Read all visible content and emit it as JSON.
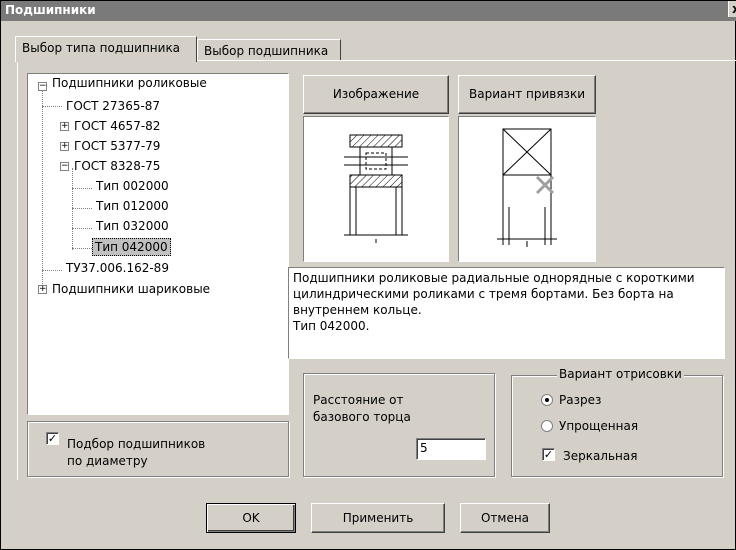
{
  "window": {
    "title": "Подшипники",
    "close_label": "x"
  },
  "tabs": [
    {
      "label": "Выбор типа подшипника",
      "active": true
    },
    {
      "label": "Выбор подшипника",
      "active": false
    }
  ],
  "tree": {
    "items": [
      {
        "label": "Подшипники роликовые",
        "expander": "−"
      },
      {
        "label": "ГОСТ 27365-87"
      },
      {
        "label": "ГОСТ 4657-82",
        "expander": "+"
      },
      {
        "label": "ГОСТ 5377-79",
        "expander": "+"
      },
      {
        "label": "ГОСТ 8328-75",
        "expander": "−"
      },
      {
        "label": "Тип 002000"
      },
      {
        "label": "Тип 012000"
      },
      {
        "label": "Тип 032000"
      },
      {
        "label": "Тип 042000",
        "selected": true
      },
      {
        "label": "ТУ37.006.162-89"
      },
      {
        "label": "Подшипники шариковые",
        "expander": "+"
      }
    ]
  },
  "buttons": {
    "image": "Изображение",
    "binding": "Вариант привязки",
    "ok": "OK",
    "apply": "Применить",
    "cancel": "Отмена"
  },
  "description": {
    "line1": "Подшипники роликовые радиальные однорядные с короткими",
    "line2": "цилиндрическими роликами с тремя бортами. Без борта на",
    "line3": "внутреннем кольце.",
    "line4": "Тип 042000."
  },
  "diameter_filter": {
    "label_line1": "Подбор подшипников",
    "label_line2": "по диаметру",
    "checked": true
  },
  "distance": {
    "label_line1": "Расстояние от",
    "label_line2": "базового торца",
    "value": "5"
  },
  "render_variant": {
    "title": "Вариант отрисовки",
    "options": [
      {
        "label": "Разрез",
        "selected": true
      },
      {
        "label": "Упрощенная",
        "selected": false
      }
    ],
    "mirror": {
      "label": "Зеркальная",
      "checked": true
    }
  },
  "colors": {
    "titlebar": "#7a7a7a",
    "face": "#d4d0c8"
  }
}
